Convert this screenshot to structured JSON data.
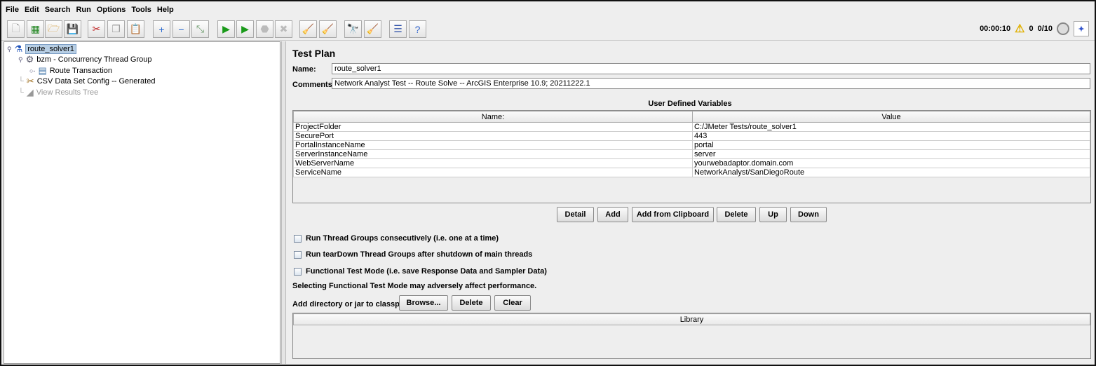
{
  "menu": [
    "File",
    "Edit",
    "Search",
    "Run",
    "Options",
    "Tools",
    "Help"
  ],
  "toolbar": [
    {
      "icon": "new-icon",
      "g": "🗋"
    },
    {
      "icon": "templates-icon",
      "g": "▦"
    },
    {
      "icon": "open-icon",
      "g": "🗁"
    },
    {
      "icon": "save-icon",
      "g": "💾"
    },
    {
      "icon": "cut-icon",
      "g": "✂"
    },
    {
      "icon": "copy-icon",
      "g": "❐"
    },
    {
      "icon": "paste-icon",
      "g": "📋"
    },
    {
      "icon": "expand-icon",
      "g": "+"
    },
    {
      "icon": "collapse-icon",
      "g": "−"
    },
    {
      "icon": "toggle-icon",
      "g": "⤡"
    },
    {
      "icon": "start-icon",
      "g": "▶"
    },
    {
      "icon": "start-no-pauses-icon",
      "g": "▶"
    },
    {
      "icon": "stop-icon",
      "g": "⬣"
    },
    {
      "icon": "shutdown-icon",
      "g": "✖"
    },
    {
      "icon": "clear-icon",
      "g": "🧹"
    },
    {
      "icon": "clear-all-icon",
      "g": "🧹"
    },
    {
      "icon": "search-icon",
      "g": "🔭"
    },
    {
      "icon": "reset-search-icon",
      "g": "🧹"
    },
    {
      "icon": "function-helper-icon",
      "g": "☰"
    },
    {
      "icon": "help-icon",
      "g": "?"
    }
  ],
  "status": {
    "elapsed": "00:00:10",
    "warnings": "0",
    "threads": "0/10"
  },
  "tree": [
    {
      "label": "route_solver1",
      "icon": "test-plan-icon"
    },
    {
      "label": "bzm - Concurrency Thread Group",
      "icon": "thread-group-icon"
    },
    {
      "label": "Route Transaction",
      "icon": "transaction-icon"
    },
    {
      "label": "CSV Data Set Config -- Generated",
      "icon": "config-icon"
    },
    {
      "label": "View Results Tree",
      "icon": "listener-icon"
    }
  ],
  "main": {
    "title": "Test Plan",
    "name_label": "Name:",
    "name_value": "route_solver1",
    "comments_label": "Comments:",
    "comments_value": "Network Analyst Test -- Route Solve -- ArcGIS Enterprise 10.9; 20211222.1",
    "udv_title": "User Defined Variables",
    "udv_headers": [
      "Name:",
      "Value"
    ],
    "udv_rows": [
      [
        "ProjectFolder",
        "C:/JMeter Tests/route_solver1"
      ],
      [
        "SecurePort",
        "443"
      ],
      [
        "PortalInstanceName",
        "portal"
      ],
      [
        "ServerInstanceName",
        "server"
      ],
      [
        "WebServerName",
        "yourwebadaptor.domain.com"
      ],
      [
        "ServiceName",
        "NetworkAnalyst/SanDiegoRoute"
      ]
    ],
    "buttons": [
      "Detail",
      "Add",
      "Add from Clipboard",
      "Delete",
      "Up",
      "Down"
    ],
    "checks": [
      "Run Thread Groups consecutively (i.e. one at a time)",
      "Run tearDown Thread Groups after shutdown of main threads",
      "Functional Test Mode (i.e. save Response Data and Sampler Data)"
    ],
    "warning": "Selecting Functional Test Mode may adversely affect performance.",
    "classpath_label": "Add directory or jar to classpath",
    "classpath_buttons": [
      "Browse...",
      "Delete",
      "Clear"
    ],
    "library_header": "Library"
  }
}
